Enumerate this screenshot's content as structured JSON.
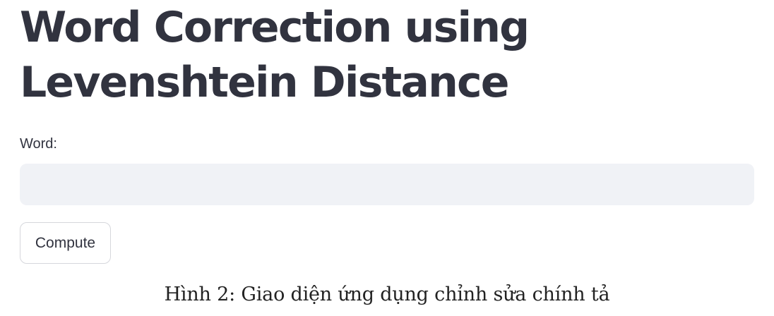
{
  "app": {
    "title": "Word Correction using Levenshtein Distance",
    "word_field": {
      "label": "Word:",
      "value": "",
      "placeholder": ""
    },
    "compute_button_label": "Compute"
  },
  "caption": "Hình 2: Giao diện ứng dụng chỉnh sửa chính tả",
  "colors": {
    "text": "#31333f",
    "input_bg": "#f0f2f6",
    "button_border": "#d6d7dc",
    "background": "#ffffff"
  }
}
